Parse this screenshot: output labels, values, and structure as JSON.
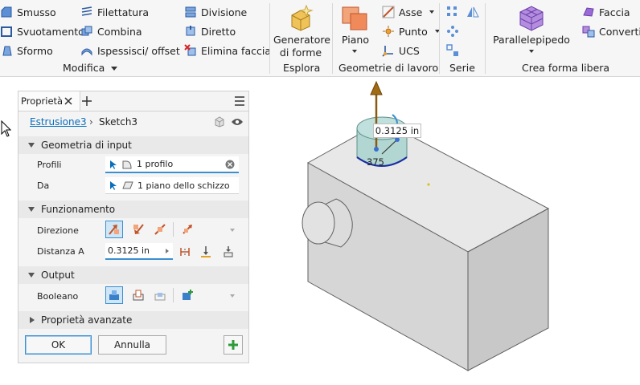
{
  "ribbon": {
    "modifica": {
      "items": [
        "Smusso",
        "Svuotamento",
        "Sformo",
        "Filettatura",
        "Combina",
        "Ispessisci/ offset",
        "Divisione",
        "Diretto",
        "Elimina faccia"
      ],
      "label": "Modifica"
    },
    "esplora": {
      "button_line1": "Generatore",
      "button_line2": "di forme",
      "label": "Esplora"
    },
    "geometrie": {
      "piano": "Piano",
      "items": [
        "Asse",
        "Punto",
        "UCS"
      ],
      "label": "Geometrie di lavoro"
    },
    "serie": {
      "label": "Serie"
    },
    "forma_libera": {
      "parallelepipedo": "Parallelepipedo",
      "items": [
        "Faccia",
        "Converti"
      ],
      "label": "Crea forma libera"
    }
  },
  "panel": {
    "tab_label": "Proprietà",
    "breadcrumb": {
      "link": "Estrusione3",
      "current": "Sketch3"
    },
    "geometria": {
      "title": "Geometria di input",
      "profili_label": "Profili",
      "profili_value": "1 profilo",
      "da_label": "Da",
      "da_value": "1 piano dello schizzo"
    },
    "funzionamento": {
      "title": "Funzionamento",
      "direzione_label": "Direzione",
      "distanza_label": "Distanza A",
      "distanza_value": "0.3125 in"
    },
    "output": {
      "title": "Output",
      "booleano_label": "Booleano"
    },
    "advanced": {
      "title": "Proprietà avanzate"
    },
    "ok_label": "OK",
    "cancel_label": "Annulla"
  },
  "viewport": {
    "dimension_label": "0.3125 in",
    "dimension_partial": "375"
  },
  "colors": {
    "accent": "#0a6ebd",
    "ok_green": "#2e9a3a",
    "extrude_preview": "#a8d3cf"
  }
}
